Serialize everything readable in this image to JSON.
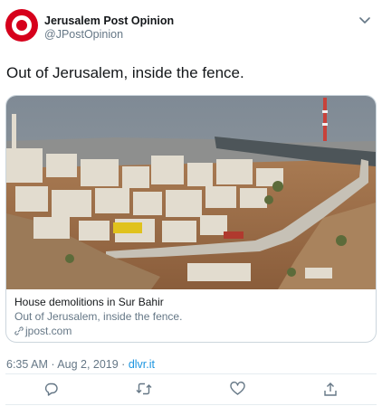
{
  "account": {
    "display_name": "Jerusalem Post Opinion",
    "handle": "@JPostOpinion",
    "brand_color": "#d6001c"
  },
  "tweet": {
    "text": "Out of Jerusalem, inside the fence."
  },
  "card": {
    "image_icon": "photo-of-town-and-separation-wall",
    "title": "House demolitions in Sur Bahir",
    "description": "Out of Jerusalem, inside the fence.",
    "domain": "jpost.com",
    "domain_icon": "link-icon"
  },
  "meta": {
    "timestamp": "6:35 AM · Aug 2, 2019 · ",
    "source": "dlvr.it"
  },
  "actions": {
    "reply_icon": "reply-icon",
    "retweet_icon": "retweet-icon",
    "like_icon": "heart-icon",
    "share_icon": "share-icon"
  },
  "colors": {
    "text": "#14171a",
    "secondary": "#657786",
    "link": "#1b95e0",
    "border": "#ccd6dd"
  }
}
